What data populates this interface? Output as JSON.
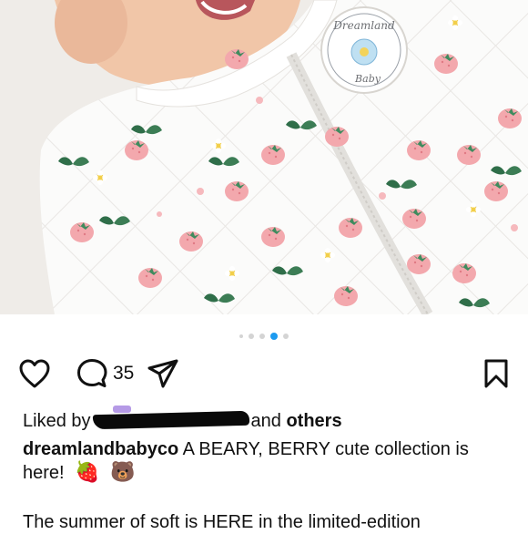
{
  "post": {
    "image_description_icon": "product-photo",
    "carousel": {
      "count": 5,
      "active_index": 3
    },
    "actions": {
      "like_icon": "heart-icon",
      "comment_icon": "comment-icon",
      "comment_count": "35",
      "share_icon": "send-icon",
      "save_icon": "bookmark-icon"
    },
    "likes": {
      "prefix": "Liked by",
      "suffix_and": "and",
      "others": "others"
    },
    "caption": {
      "username": "dreamlandbabyco",
      "text": "A BEARY, BERRY cute collection is here!",
      "emoji_1": "🍓",
      "emoji_2": "🐻"
    },
    "body": "The summer of soft is HERE in the limited-edition",
    "badge_text": "Dreamland Baby"
  },
  "colors": {
    "active_dot": "#1d9bf0",
    "inactive_dot": "#d4d4d4"
  }
}
